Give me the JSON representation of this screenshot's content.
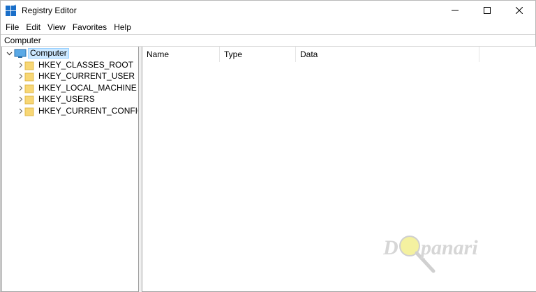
{
  "window": {
    "title": "Registry Editor",
    "accent_color": "#1a6fc9"
  },
  "menubar": {
    "items": [
      "File",
      "Edit",
      "View",
      "Favorites",
      "Help"
    ]
  },
  "address": {
    "path": "Computer"
  },
  "tree": {
    "root": "Computer",
    "hives": [
      "HKEY_CLASSES_ROOT",
      "HKEY_CURRENT_USER",
      "HKEY_LOCAL_MACHINE",
      "HKEY_USERS",
      "HKEY_CURRENT_CONFIG"
    ],
    "selection_color": "#cce8ff",
    "folder_color": "#f8d775"
  },
  "list": {
    "columns": [
      "Name",
      "Type",
      "Data"
    ]
  },
  "watermark": {
    "text_left": "D",
    "text_right": "panari"
  }
}
